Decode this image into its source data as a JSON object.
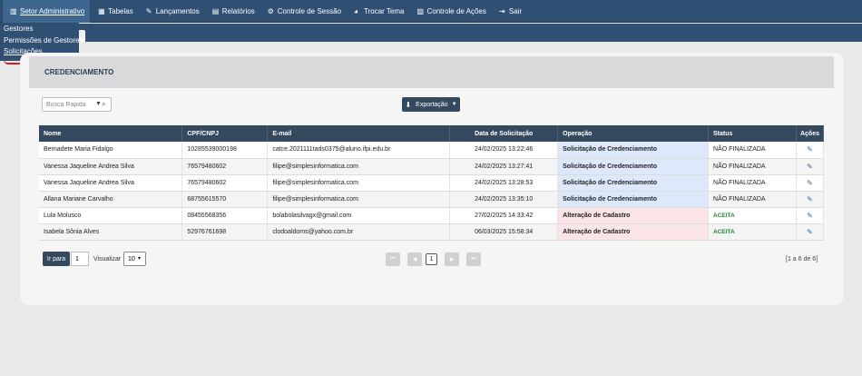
{
  "menu": [
    {
      "label": "Setor Administrativo",
      "icon": "building-icon",
      "glyph": "▥",
      "active": true
    },
    {
      "label": "Tabelas",
      "icon": "table-icon",
      "glyph": "▦"
    },
    {
      "label": "Lançamentos",
      "icon": "pencil-icon",
      "glyph": "✎"
    },
    {
      "label": "Relatórios",
      "icon": "report-icon",
      "glyph": "▤"
    },
    {
      "label": "Controle de Sessão",
      "icon": "gear-icon",
      "glyph": "⚙"
    },
    {
      "label": "Trocar Tema",
      "icon": "palette-icon",
      "glyph": "◕"
    },
    {
      "label": "Controle de Ações",
      "icon": "chart-icon",
      "glyph": "▨"
    },
    {
      "label": "Sair",
      "icon": "logout-icon",
      "glyph": "⇥"
    }
  ],
  "dropdown": [
    "Gestores",
    "Permissões de Gestores",
    "Solicitações"
  ],
  "section_title": "CREDENCIAMENTO",
  "search": {
    "placeholder": "Busca Rapida"
  },
  "export_label": "Exportação",
  "table": {
    "headers": [
      "Nome",
      "CPF/CNPJ",
      "E-mail",
      "Data de Solicitação",
      "Operação",
      "Status",
      "Ações"
    ],
    "rows": [
      {
        "nome": "Bernadete Maria Fidalgo",
        "doc": "10285539000198",
        "email": "catce.2021111tads0375@aluno.ifpi.edu.br",
        "data": "24/02/2025 13:22:46",
        "op": "Solicitação de Credenciamento",
        "status": "NÃO FINALIZADA"
      },
      {
        "nome": "Vanessa Jaqueline Andrea Silva",
        "doc": "76579480602",
        "email": "filipe@simplesinformatica.com",
        "data": "24/02/2025 13:27:41",
        "op": "Solicitação de Credenciamento",
        "status": "NÃO FINALIZADA"
      },
      {
        "nome": "Vanessa Jaqueline Andrea Silva",
        "doc": "76579480602",
        "email": "filipe@simplesinformatica.com",
        "data": "24/02/2025 13:28:53",
        "op": "Solicitação de Credenciamento",
        "status": "NÃO FINALIZADA"
      },
      {
        "nome": "Allana Mariane Carvalho",
        "doc": "68755615570",
        "email": "filipe@simplesinformatica.com",
        "data": "24/02/2025 13:35:10",
        "op": "Solicitação de Credenciamento",
        "status": "NÃO FINALIZADA"
      },
      {
        "nome": "Lula Molusco",
        "doc": "08455568356",
        "email": "bolabolasilvagx@gmail.com",
        "data": "27/02/2025 14:33:42",
        "op": "Alteração de Cadastro",
        "status": "ACEITA"
      },
      {
        "nome": "Isabela Sônia Alves",
        "doc": "52976761698",
        "email": "clodoaldoms@yahoo.com.br",
        "data": "06/03/2025 15:58:34",
        "op": "Alteração de Cadastro",
        "status": "ACEITA"
      }
    ]
  },
  "pagination": {
    "go_label": "Ir para",
    "go_value": "1",
    "view_label": "Visualizar",
    "per_page": "10",
    "current_page": "1",
    "summary": "[1 a 6 de 6]"
  }
}
